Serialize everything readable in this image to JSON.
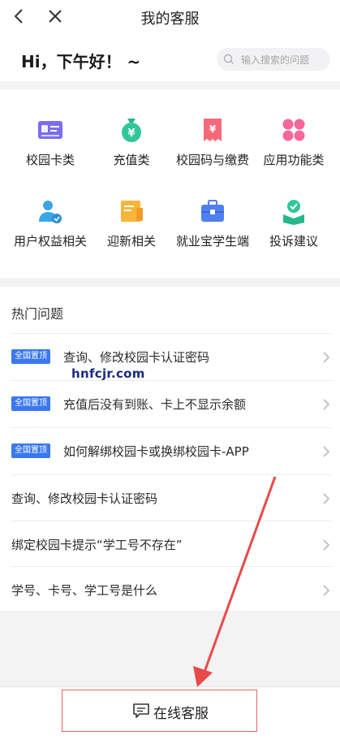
{
  "nav": {
    "title": "我的客服"
  },
  "greeting": {
    "text": "Hi，下午好！ ~"
  },
  "search": {
    "placeholder": "输入搜索的问题"
  },
  "categories": [
    {
      "label": "校园卡类",
      "icon": "id-card-icon"
    },
    {
      "label": "充值类",
      "icon": "money-bag-icon"
    },
    {
      "label": "校园码与缴费",
      "icon": "receipt-icon"
    },
    {
      "label": "应用功能类",
      "icon": "apps-icon"
    },
    {
      "label": "用户权益相关",
      "icon": "user-shield-icon"
    },
    {
      "label": "迎新相关",
      "icon": "welcome-doc-icon"
    },
    {
      "label": "就业宝学生端",
      "icon": "briefcase-icon"
    },
    {
      "label": "投诉建议",
      "icon": "feedback-icon"
    }
  ],
  "hot": {
    "title": "热门问题",
    "badge": "全国置顶",
    "items": [
      {
        "text": "查询、修改校园卡认证密码",
        "pinned": true
      },
      {
        "text": "充值后没有到账、卡上不显示余额",
        "pinned": true
      },
      {
        "text": "如何解绑校园卡或换绑校园卡-APP",
        "pinned": true
      },
      {
        "text": "查询、修改校园卡认证密码",
        "pinned": false
      },
      {
        "text": "绑定校园卡提示“学工号不存在”",
        "pinned": false
      },
      {
        "text": "学号、卡号、学工号是什么",
        "pinned": false
      }
    ]
  },
  "watermark": "hnfcjr.com",
  "bottom": {
    "chat_label": "在线客服"
  },
  "colors": {
    "accent": "#3a78f0",
    "annotation": "#e84a4a"
  }
}
